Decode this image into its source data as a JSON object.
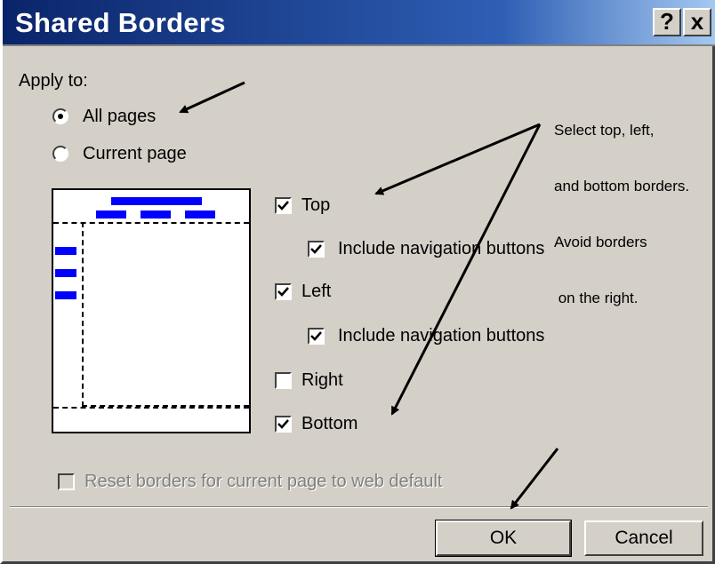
{
  "dialog": {
    "title": "Shared Borders",
    "help_glyph": "?",
    "close_glyph": "x"
  },
  "apply_to": {
    "label": "Apply to:",
    "options": [
      {
        "label": "All pages",
        "selected": true
      },
      {
        "label": "Current page",
        "selected": false
      }
    ]
  },
  "borders": {
    "top": {
      "label": "Top",
      "checked": true
    },
    "top_nav": {
      "label": "Include navigation buttons",
      "checked": true
    },
    "left": {
      "label": "Left",
      "checked": true
    },
    "left_nav": {
      "label": "Include navigation buttons",
      "checked": true
    },
    "right": {
      "label": "Right",
      "checked": false
    },
    "bottom": {
      "label": "Bottom",
      "checked": true
    }
  },
  "reset": {
    "label": "Reset borders for current page to web default",
    "enabled": false,
    "checked": false
  },
  "buttons": {
    "ok": "OK",
    "cancel": "Cancel"
  },
  "annotation": {
    "lines": [
      "Select top, left,",
      "and bottom borders.",
      "Avoid borders",
      " on the right."
    ]
  },
  "colors": {
    "nav_bars": "#0000ff",
    "title_bar": "#0a246a",
    "dialog_bg": "#d4d0c8"
  }
}
